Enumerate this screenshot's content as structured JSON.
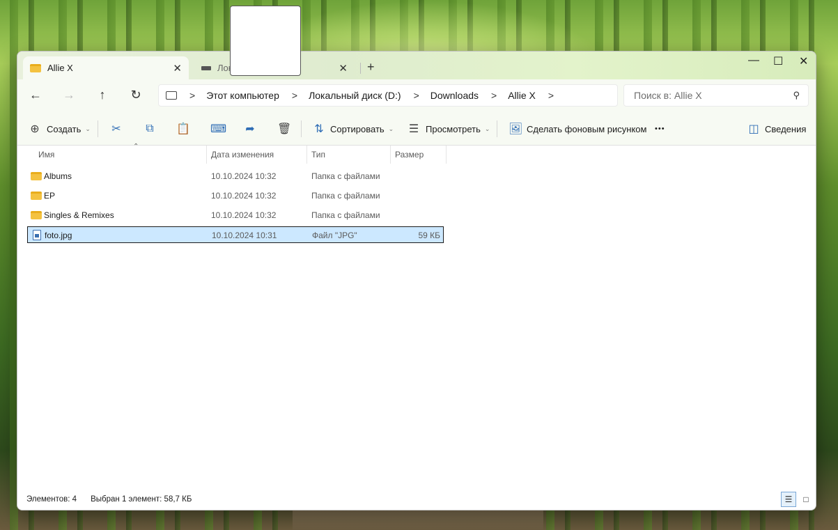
{
  "tabs": [
    {
      "label": "Allie X",
      "close": "✕"
    },
    {
      "label": "Лока",
      "close": "✕"
    }
  ],
  "new_tab": "+",
  "window_controls": {
    "minimize": "—",
    "maximize": "☐",
    "close": "✕"
  },
  "nav": {
    "back": "←",
    "forward": "→",
    "up": "↑",
    "refresh": "↻"
  },
  "breadcrumb": [
    "Этот компьютер",
    "Локальный диск (D:)",
    "Downloads",
    "Allie X"
  ],
  "breadcrumb_sep": ">",
  "search": {
    "placeholder": "Поиск в: Allie X",
    "icon": "search-icon"
  },
  "toolbar": {
    "create": "Создать",
    "sort": "Сортировать",
    "view": "Просмотреть",
    "set_wallpaper": "Сделать фоновым рисунком",
    "more": "•••",
    "details": "Сведения"
  },
  "columns": {
    "name": "Имя",
    "date": "Дата изменения",
    "type": "Тип",
    "size": "Размер"
  },
  "files": [
    {
      "name": "Albums",
      "date": "10.10.2024 10:32",
      "type": "Папка с файлами",
      "size": "",
      "kind": "folder"
    },
    {
      "name": "EP",
      "date": "10.10.2024 10:32",
      "type": "Папка с файлами",
      "size": "",
      "kind": "folder"
    },
    {
      "name": "Singles & Remixes",
      "date": "10.10.2024 10:32",
      "type": "Папка с файлами",
      "size": "",
      "kind": "folder"
    },
    {
      "name": "foto.jpg",
      "date": "10.10.2024 10:31",
      "type": "Файл \"JPG\"",
      "size": "59 КБ",
      "kind": "file",
      "selected": true
    }
  ],
  "status": {
    "count": "Элементов: 4",
    "selection": "Выбран 1 элемент: 58,7 КБ"
  },
  "colors": {
    "accent": "#2f6db5",
    "selection": "#cce8ff",
    "folder": "#f4c240"
  }
}
